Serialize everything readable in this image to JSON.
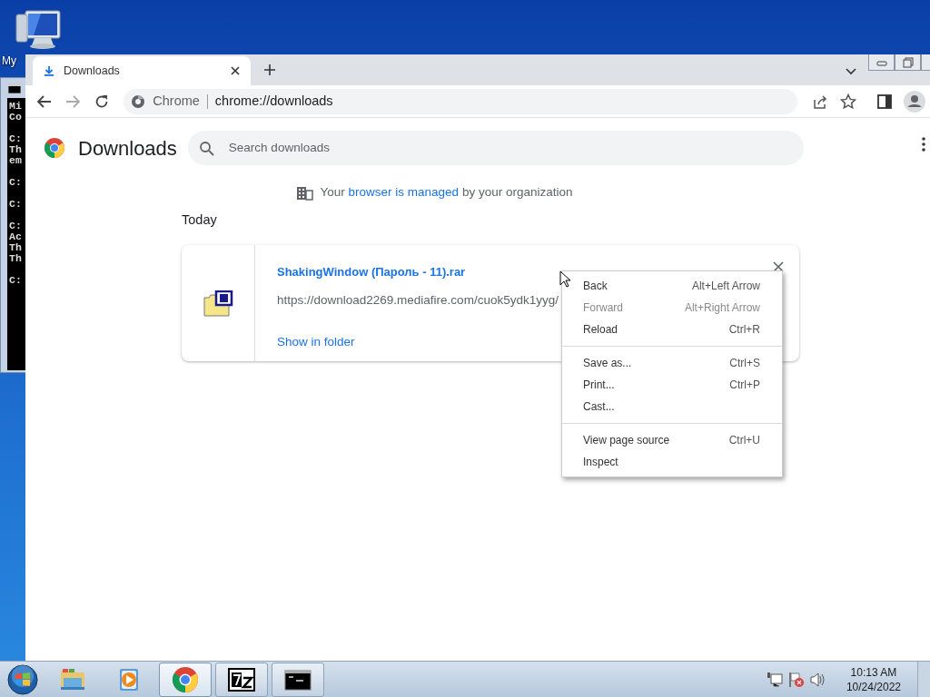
{
  "desktop": {
    "icons": [
      {
        "label": "My"
      }
    ]
  },
  "console_window": {
    "blocks": [
      [
        "Mi",
        "Co"
      ],
      [
        "C:",
        "Th",
        "em"
      ],
      [
        "C:"
      ],
      [
        "C:"
      ],
      [
        "C:",
        "Ac",
        "Th",
        "Th"
      ],
      [
        "C:"
      ]
    ]
  },
  "browser": {
    "tabs": [
      {
        "title": "Downloads",
        "selected": true
      }
    ],
    "address": {
      "site_label": "Chrome",
      "url": "chrome://downloads"
    },
    "page": {
      "title": "Downloads",
      "search": {
        "placeholder": "Search downloads"
      },
      "managed_notice": {
        "before": "Your",
        "link": "browser is managed",
        "after": "by your organization"
      },
      "section_heading": "Today",
      "downloads": [
        {
          "file_name": "ShakingWindow (Пароль - 11).rar",
          "url": "https://download2269.mediafire.com/cuok5ydk1yyg/",
          "action": "Show in folder"
        }
      ]
    }
  },
  "context_menu": {
    "groups": [
      [
        {
          "label": "Back",
          "shortcut": "Alt+Left Arrow",
          "disabled": false
        },
        {
          "label": "Forward",
          "shortcut": "Alt+Right Arrow",
          "disabled": true
        },
        {
          "label": "Reload",
          "shortcut": "Ctrl+R",
          "disabled": false
        }
      ],
      [
        {
          "label": "Save as...",
          "shortcut": "Ctrl+S",
          "disabled": false
        },
        {
          "label": "Print...",
          "shortcut": "Ctrl+P",
          "disabled": false
        },
        {
          "label": "Cast...",
          "disabled": false
        }
      ],
      [
        {
          "label": "View page source",
          "shortcut": "Ctrl+U",
          "disabled": false
        },
        {
          "label": "Inspect",
          "disabled": false
        }
      ]
    ]
  },
  "taskbar": {
    "apps": [
      {
        "kind": "explorer",
        "running": false,
        "selected": false
      },
      {
        "kind": "media",
        "running": false,
        "selected": false
      },
      {
        "kind": "chrome",
        "running": true,
        "selected": true
      },
      {
        "kind": "sevenzip",
        "running": true,
        "selected": false
      },
      {
        "kind": "console",
        "running": true,
        "selected": false
      }
    ],
    "clock": {
      "time": "10:13 AM",
      "date": "10/24/2022"
    }
  }
}
